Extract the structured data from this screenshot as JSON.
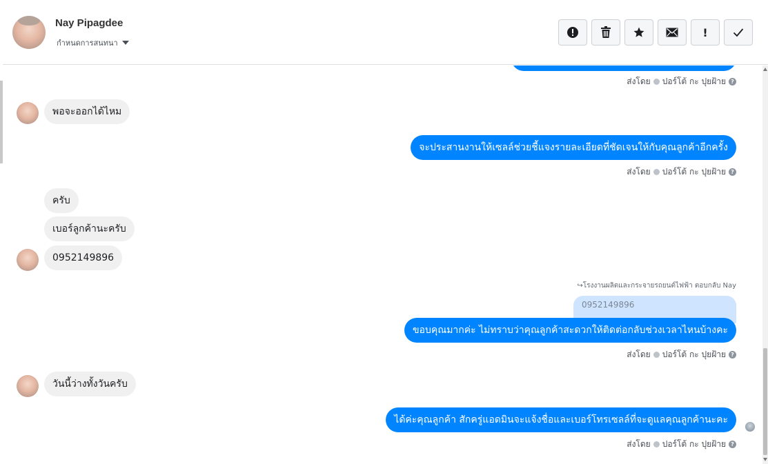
{
  "header": {
    "contact_name": "Nay Pipagdee",
    "status_label": "กำหนดการสนทนา",
    "toolbar": {
      "spam_icon": "exclamation-circle-icon",
      "delete_icon": "trash-icon",
      "star_icon": "star-icon",
      "mail_icon": "envelope-icon",
      "important_label": "!",
      "done_icon": "check-icon"
    }
  },
  "sent_by": {
    "prefix": "ส่งโดย",
    "sender": "ปอร์โต้ กะ ปุยฝ้าย",
    "help": "?"
  },
  "messages": [
    {
      "dir": "in",
      "text": "พอจะออกได้ไหม"
    },
    {
      "dir": "out",
      "text": "จะประสานงานให้เซลล์ช่วยชี้แจงรายละเอียดที่ชัดเจนให้กับคุณลูกค้าอีกครั้ง"
    },
    {
      "dir": "in",
      "text": "ครับ"
    },
    {
      "dir": "in",
      "text": "เบอร์ลูกค้านะครับ"
    },
    {
      "dir": "in",
      "text": "0952149896"
    },
    {
      "dir": "out",
      "reply_note": "↪โรงงานผลิตและกระจายรถยนต์ไฟฟ้า ตอบกลับ Nay",
      "quoted": "0952149896",
      "text": "ขอบคุณมากค่ะ ไม่ทราบว่าคุณลูกค้าสะดวกให้ติดต่อกลับช่วงเวลาไหนบ้างคะ"
    },
    {
      "dir": "in",
      "text": "วันนี้ว่างทั้งวันครับ"
    },
    {
      "dir": "out",
      "text": "ได้ค่ะคุณลูกค้า สักครู่แอดมินจะแจ้งชื่อและเบอร์โทรเซลล์ที่จะดูแลคุณลูกค้านะคะ"
    }
  ],
  "colors": {
    "outgoing": "#0084ff",
    "incoming": "#f1f0f0"
  }
}
